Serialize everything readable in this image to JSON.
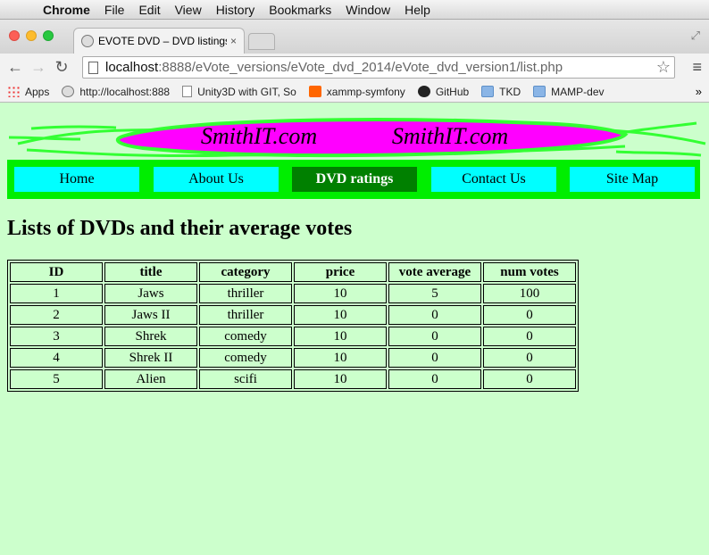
{
  "menubar": {
    "app": "Chrome",
    "items": [
      "File",
      "Edit",
      "View",
      "History",
      "Bookmarks",
      "Window",
      "Help"
    ]
  },
  "tab": {
    "title": "EVOTE DVD – DVD listings",
    "close": "×"
  },
  "toolbar": {
    "url_host": "localhost",
    "url_rest": ":8888/eVote_versions/eVote_dvd_2014/eVote_dvd_version1/list.php"
  },
  "bookmarks": {
    "items": [
      {
        "label": "Apps",
        "icon": "apps-icon"
      },
      {
        "label": "http://localhost:888",
        "icon": "globe-icon"
      },
      {
        "label": "Unity3D with GIT, So",
        "icon": "doc-icon"
      },
      {
        "label": "xammp-symfony",
        "icon": "xampp-icon"
      },
      {
        "label": "GitHub",
        "icon": "github-icon"
      },
      {
        "label": "TKD",
        "icon": "folder-icon"
      },
      {
        "label": "MAMP-dev",
        "icon": "folder-icon"
      }
    ],
    "more": "»"
  },
  "banner": {
    "text_left": "SmithIT.com",
    "text_right": "SmithIT.com",
    "color_stroke": "#33ff33",
    "color_fill": "#ff00ff"
  },
  "nav": {
    "items": [
      "Home",
      "About Us",
      "DVD ratings",
      "Contact Us",
      "Site Map"
    ],
    "active": "DVD ratings"
  },
  "main": {
    "heading": "Lists of DVDs and their average votes",
    "table": {
      "headers": [
        "ID",
        "title",
        "category",
        "price",
        "vote average",
        "num votes"
      ],
      "rows": [
        [
          "1",
          "Jaws",
          "thriller",
          "10",
          "5",
          "100"
        ],
        [
          "2",
          "Jaws II",
          "thriller",
          "10",
          "0",
          "0"
        ],
        [
          "3",
          "Shrek",
          "comedy",
          "10",
          "0",
          "0"
        ],
        [
          "4",
          "Shrek II",
          "comedy",
          "10",
          "0",
          "0"
        ],
        [
          "5",
          "Alien",
          "scifi",
          "10",
          "0",
          "0"
        ]
      ]
    }
  }
}
